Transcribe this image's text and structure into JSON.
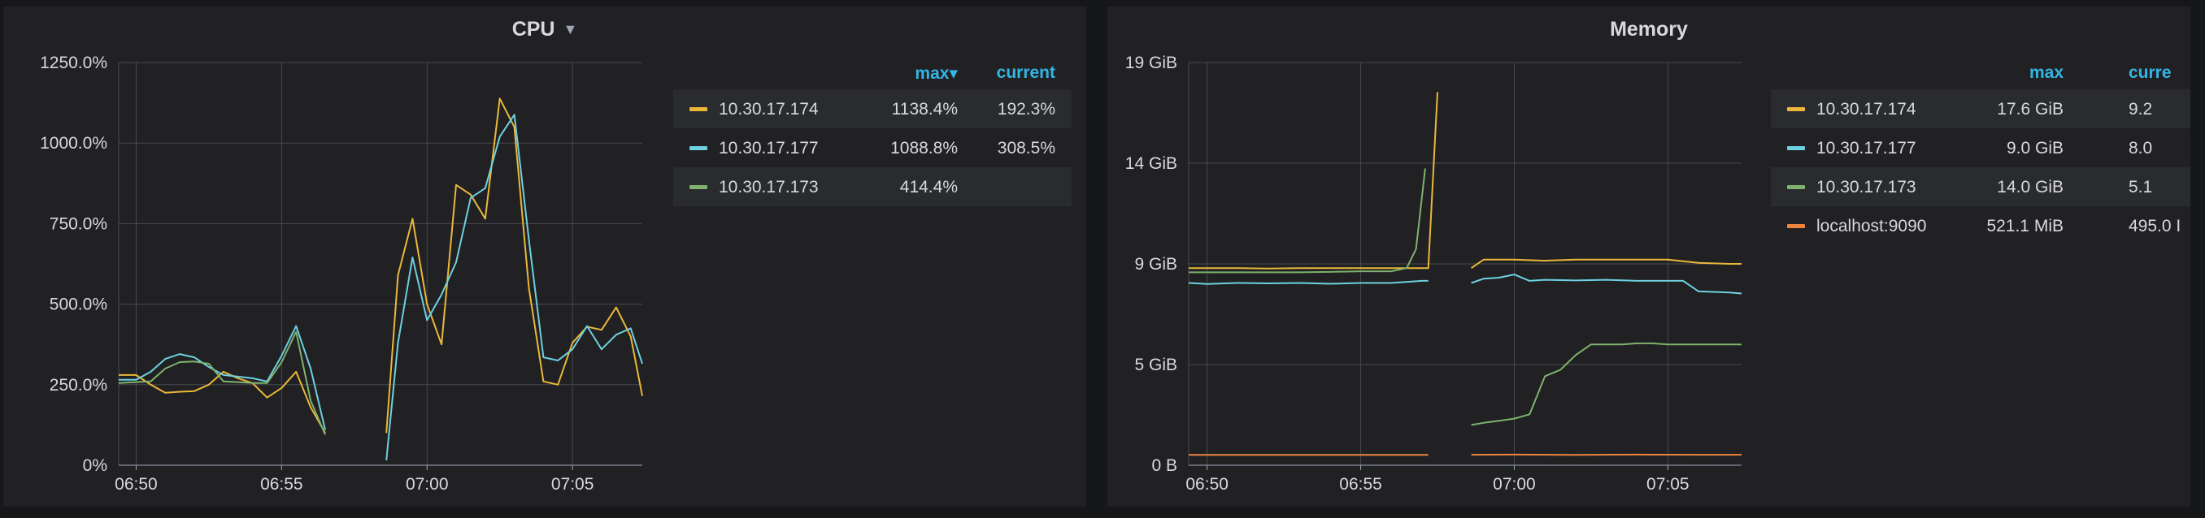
{
  "panels": [
    {
      "title": "CPU",
      "legend": {
        "columns": [
          "max",
          "current"
        ],
        "sort_indicator": "▾",
        "rows": [
          {
            "name": "10.30.17.174",
            "max": "1138.4%",
            "current": "192.3%",
            "color": "#eab839"
          },
          {
            "name": "10.30.17.177",
            "max": "1088.8%",
            "current": "308.5%",
            "color": "#6ed0e0"
          },
          {
            "name": "10.30.17.173",
            "max": "414.4%",
            "current": "",
            "color": "#7eb26d"
          }
        ]
      }
    },
    {
      "title": "Memory",
      "legend": {
        "columns": [
          "max",
          "curre"
        ],
        "sort_indicator": "",
        "rows": [
          {
            "name": "10.30.17.174",
            "max": "17.6 GiB",
            "current": "9.2",
            "color": "#eab839"
          },
          {
            "name": "10.30.17.177",
            "max": "9.0 GiB",
            "current": "8.0",
            "color": "#6ed0e0"
          },
          {
            "name": "10.30.17.173",
            "max": "14.0 GiB",
            "current": "5.1",
            "color": "#7eb26d"
          },
          {
            "name": "localhost:9090",
            "max": "521.1 MiB",
            "current": "495.0 I",
            "color": "#ef843c"
          }
        ]
      }
    }
  ],
  "chart_data": [
    {
      "type": "line",
      "title": "CPU",
      "x_ticks": [
        "06:50",
        "06:55",
        "07:00",
        "07:05"
      ],
      "y_ticks": [
        "0%",
        "250.0%",
        "500.0%",
        "750.0%",
        "1000.0%",
        "1250.0%"
      ],
      "x_range_minutes": [
        -0.6,
        7.4
      ],
      "ylim": [
        0,
        1250
      ],
      "x_unit": "minutes from 07:00",
      "y_unit": "%",
      "grid": true,
      "series": [
        {
          "name": "10.30.17.174",
          "color": "#eab839",
          "segments": [
            [
              [
                -10.6,
                280
              ],
              [
                -10.0,
                280
              ],
              [
                -9.5,
                250
              ],
              [
                -9.0,
                225
              ],
              [
                -8.5,
                228
              ],
              [
                -8.0,
                230
              ],
              [
                -7.5,
                250
              ],
              [
                -7.0,
                290
              ],
              [
                -6.5,
                270
              ],
              [
                -6.0,
                255
              ],
              [
                -5.5,
                210
              ],
              [
                -5.0,
                240
              ],
              [
                -4.5,
                290
              ],
              [
                -4.0,
                180
              ],
              [
                -3.5,
                100
              ]
            ],
            [
              [
                -1.4,
                100
              ],
              [
                -1.0,
                590
              ],
              [
                -0.5,
                765
              ],
              [
                0.0,
                500
              ],
              [
                0.5,
                375
              ],
              [
                1.0,
                870
              ],
              [
                1.5,
                840
              ],
              [
                2.0,
                765
              ],
              [
                2.5,
                1138
              ],
              [
                3.0,
                1050
              ],
              [
                3.5,
                550
              ],
              [
                4.0,
                260
              ],
              [
                4.5,
                250
              ],
              [
                5.0,
                380
              ],
              [
                5.5,
                430
              ],
              [
                6.0,
                420
              ],
              [
                6.5,
                490
              ],
              [
                7.0,
                400
              ],
              [
                7.4,
                215
              ]
            ]
          ]
        },
        {
          "name": "10.30.17.177",
          "color": "#6ed0e0",
          "segments": [
            [
              [
                -10.6,
                265
              ],
              [
                -10.0,
                265
              ],
              [
                -9.5,
                290
              ],
              [
                -9.0,
                330
              ],
              [
                -8.5,
                345
              ],
              [
                -8.0,
                335
              ],
              [
                -7.5,
                305
              ],
              [
                -7.0,
                280
              ],
              [
                -6.5,
                275
              ],
              [
                -6.0,
                270
              ],
              [
                -5.5,
                260
              ],
              [
                -5.0,
                340
              ],
              [
                -4.5,
                432
              ],
              [
                -4.0,
                300
              ],
              [
                -3.5,
                110
              ]
            ],
            [
              [
                -1.4,
                15
              ],
              [
                -1.0,
                380
              ],
              [
                -0.5,
                645
              ],
              [
                0.0,
                450
              ],
              [
                0.5,
                530
              ],
              [
                1.0,
                630
              ],
              [
                1.5,
                830
              ],
              [
                2.0,
                860
              ],
              [
                2.5,
                1020
              ],
              [
                3.0,
                1088
              ],
              [
                3.5,
                700
              ],
              [
                4.0,
                335
              ],
              [
                4.5,
                325
              ],
              [
                5.0,
                360
              ],
              [
                5.5,
                432
              ],
              [
                6.0,
                360
              ],
              [
                6.5,
                405
              ],
              [
                7.0,
                425
              ],
              [
                7.4,
                315
              ]
            ]
          ]
        },
        {
          "name": "10.30.17.173",
          "color": "#7eb26d",
          "segments": [
            [
              [
                -10.6,
                255
              ],
              [
                -10.0,
                258
              ],
              [
                -9.5,
                260
              ],
              [
                -9.0,
                300
              ],
              [
                -8.5,
                320
              ],
              [
                -8.0,
                322
              ],
              [
                -7.5,
                315
              ],
              [
                -7.0,
                260
              ],
              [
                -6.5,
                258
              ],
              [
                -6.0,
                255
              ],
              [
                -5.5,
                255
              ],
              [
                -5.0,
                320
              ],
              [
                -4.5,
                414
              ],
              [
                -4.0,
                200
              ],
              [
                -3.5,
                95
              ]
            ]
          ]
        }
      ]
    },
    {
      "type": "line",
      "title": "Memory",
      "x_ticks": [
        "06:50",
        "06:55",
        "07:00",
        "07:05"
      ],
      "y_ticks": [
        "0 B",
        "5 GiB",
        "9 GiB",
        "14 GiB",
        "19 GiB"
      ],
      "y_tick_values": [
        0,
        4.75,
        9.5,
        14.25,
        19
      ],
      "x_range_minutes": [
        -10.6,
        7.4
      ],
      "ylim": [
        0,
        19
      ],
      "x_unit": "minutes from 07:00",
      "y_unit": "GiB",
      "grid": true,
      "series": [
        {
          "name": "10.30.17.174",
          "color": "#eab839",
          "segments": [
            [
              [
                -10.6,
                9.3
              ],
              [
                -10,
                9.3
              ],
              [
                -9,
                9.3
              ],
              [
                -8,
                9.28
              ],
              [
                -7,
                9.3
              ],
              [
                -6,
                9.3
              ],
              [
                -5,
                9.3
              ],
              [
                -4,
                9.3
              ],
              [
                -3,
                9.3
              ],
              [
                -2.8,
                9.3
              ],
              [
                -2.5,
                17.6
              ]
            ],
            [
              [
                -1.4,
                9.3
              ],
              [
                -1.0,
                9.7
              ],
              [
                0,
                9.7
              ],
              [
                1,
                9.65
              ],
              [
                2,
                9.7
              ],
              [
                3,
                9.7
              ],
              [
                4,
                9.7
              ],
              [
                5,
                9.7
              ],
              [
                6,
                9.55
              ],
              [
                7,
                9.5
              ],
              [
                7.4,
                9.5
              ]
            ]
          ]
        },
        {
          "name": "10.30.17.177",
          "color": "#6ed0e0",
          "segments": [
            [
              [
                -10.6,
                8.6
              ],
              [
                -10,
                8.55
              ],
              [
                -9,
                8.6
              ],
              [
                -8,
                8.58
              ],
              [
                -7,
                8.6
              ],
              [
                -6,
                8.56
              ],
              [
                -5,
                8.6
              ],
              [
                -4,
                8.6
              ],
              [
                -3,
                8.7
              ],
              [
                -2.8,
                8.7
              ]
            ],
            [
              [
                -1.4,
                8.6
              ],
              [
                -1.0,
                8.8
              ],
              [
                -0.5,
                8.85
              ],
              [
                0,
                9.0
              ],
              [
                0.5,
                8.7
              ],
              [
                1,
                8.75
              ],
              [
                2,
                8.72
              ],
              [
                3,
                8.75
              ],
              [
                4,
                8.7
              ],
              [
                5,
                8.7
              ],
              [
                5.5,
                8.7
              ],
              [
                6,
                8.2
              ],
              [
                7,
                8.15
              ],
              [
                7.4,
                8.1
              ]
            ]
          ]
        },
        {
          "name": "10.30.17.173",
          "color": "#7eb26d",
          "segments": [
            [
              [
                -10.6,
                9.1
              ],
              [
                -10,
                9.1
              ],
              [
                -9,
                9.1
              ],
              [
                -8,
                9.1
              ],
              [
                -7,
                9.1
              ],
              [
                -6,
                9.12
              ],
              [
                -5,
                9.15
              ],
              [
                -4,
                9.15
              ],
              [
                -3.5,
                9.3
              ],
              [
                -3.2,
                10.2
              ],
              [
                -2.9,
                14.0
              ]
            ],
            [
              [
                -1.4,
                1.9
              ],
              [
                -1.0,
                2.0
              ],
              [
                -0.5,
                2.1
              ],
              [
                0,
                2.2
              ],
              [
                0.5,
                2.4
              ],
              [
                1.0,
                4.2
              ],
              [
                1.5,
                4.5
              ],
              [
                2.0,
                5.2
              ],
              [
                2.5,
                5.7
              ],
              [
                3.0,
                5.7
              ],
              [
                3.5,
                5.7
              ],
              [
                4.0,
                5.75
              ],
              [
                4.5,
                5.75
              ],
              [
                5.0,
                5.7
              ],
              [
                6,
                5.7
              ],
              [
                7,
                5.7
              ],
              [
                7.4,
                5.7
              ]
            ]
          ]
        },
        {
          "name": "localhost:9090",
          "color": "#ef843c",
          "segments": [
            [
              [
                -10.6,
                0.49
              ],
              [
                -9,
                0.49
              ],
              [
                -7,
                0.49
              ],
              [
                -5,
                0.49
              ],
              [
                -3,
                0.49
              ],
              [
                -2.8,
                0.49
              ]
            ],
            [
              [
                -1.4,
                0.495
              ],
              [
                0,
                0.5
              ],
              [
                2,
                0.49
              ],
              [
                4,
                0.5
              ],
              [
                6,
                0.495
              ],
              [
                7.4,
                0.495
              ]
            ]
          ]
        }
      ]
    }
  ]
}
